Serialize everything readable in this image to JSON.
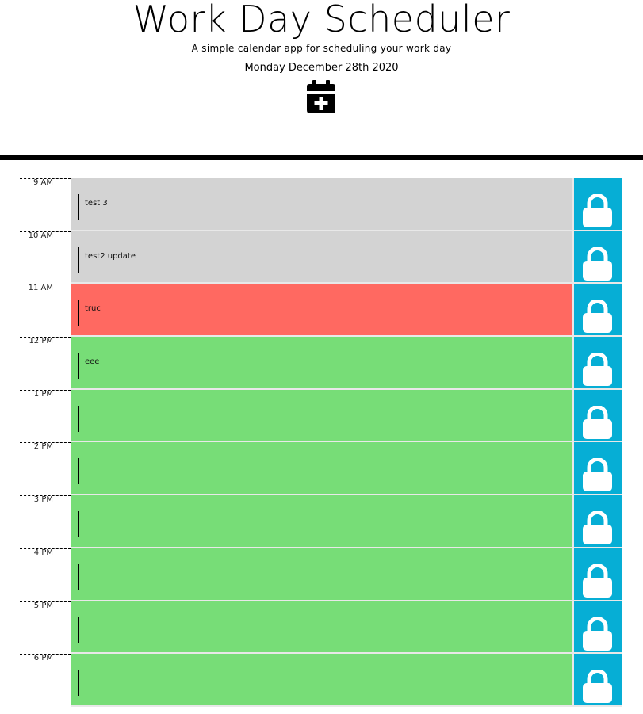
{
  "header": {
    "title": "Work Day Scheduler",
    "subtitle": "A simple calendar app for scheduling your work day",
    "date": "Monday December 28th 2020",
    "icon": "calendar-plus-icon"
  },
  "colors": {
    "past": "#d3d3d3",
    "present": "#ff6961",
    "future": "#77dd77",
    "save_button": "#06aed5"
  },
  "time_blocks": [
    {
      "hour": "9 AM",
      "text": "test 3",
      "state": "past"
    },
    {
      "hour": "10 AM",
      "text": "test2 update",
      "state": "past"
    },
    {
      "hour": "11 AM",
      "text": "truc",
      "state": "present"
    },
    {
      "hour": "12 PM",
      "text": "eee",
      "state": "future"
    },
    {
      "hour": "1 PM",
      "text": "",
      "state": "future"
    },
    {
      "hour": "2 PM",
      "text": "",
      "state": "future"
    },
    {
      "hour": "3 PM",
      "text": "",
      "state": "future"
    },
    {
      "hour": "4 PM",
      "text": "",
      "state": "future"
    },
    {
      "hour": "5 PM",
      "text": "",
      "state": "future"
    },
    {
      "hour": "6 PM",
      "text": "",
      "state": "future"
    }
  ],
  "save_icon": "lock-icon"
}
